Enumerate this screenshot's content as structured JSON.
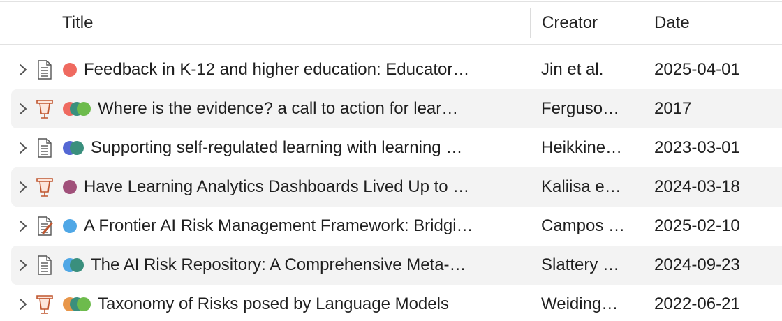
{
  "columns": {
    "title": "Title",
    "creator": "Creator",
    "date": "Date"
  },
  "rows": [
    {
      "item_type": "document",
      "tag_colors": [
        "#ef6a60"
      ],
      "title": "Feedback in K-12 and higher education: Educator…",
      "creator": "Jin et al.",
      "date": "2025-04-01"
    },
    {
      "item_type": "presentation",
      "tag_colors": [
        "#ef6a60",
        "#3a8f7d",
        "#6dbb4c"
      ],
      "title": "Where is the evidence? a call to action for lear…",
      "creator": "Ferguso…",
      "date": "2017"
    },
    {
      "item_type": "document",
      "tag_colors": [
        "#5468d4",
        "#3a8f7d"
      ],
      "title": "Supporting self-regulated learning with learning …",
      "creator": "Heikkine…",
      "date": "2023-03-01"
    },
    {
      "item_type": "presentation",
      "tag_colors": [
        "#a0507a"
      ],
      "title": "Have Learning Analytics Dashboards Lived Up to …",
      "creator": "Kaliisa e…",
      "date": "2024-03-18"
    },
    {
      "item_type": "manuscript",
      "tag_colors": [
        "#4fa7e6"
      ],
      "title": "A Frontier AI Risk Management Framework: Bridgi…",
      "creator": "Campos …",
      "date": "2025-02-10"
    },
    {
      "item_type": "document",
      "tag_colors": [
        "#4fa7e6",
        "#3a8f7d"
      ],
      "title": "The AI Risk Repository: A Comprehensive Meta-…",
      "creator": "Slattery …",
      "date": "2024-09-23"
    },
    {
      "item_type": "presentation",
      "tag_colors": [
        "#e8964a",
        "#3a8f7d",
        "#6dbb4c"
      ],
      "title": "Taxonomy of Risks posed by Language Models",
      "creator": "Weiding…",
      "date": "2022-06-21"
    }
  ]
}
